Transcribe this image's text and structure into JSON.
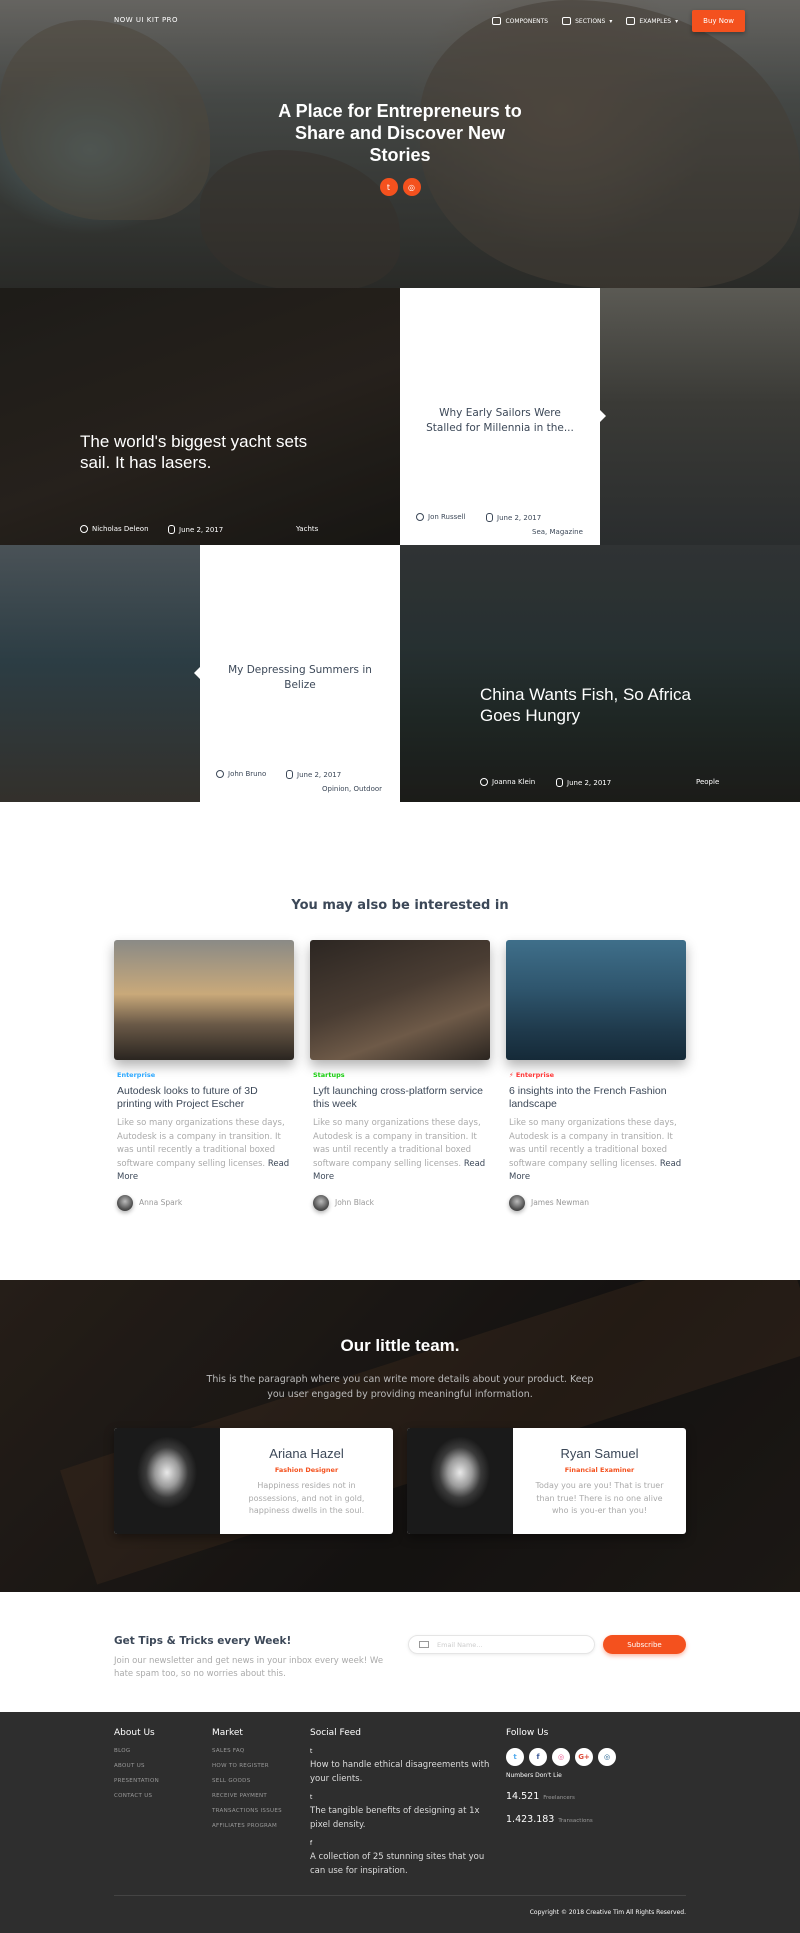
{
  "nav": {
    "brand": "NOW UI KIT PRO",
    "items": [
      {
        "label": "COMPONENTS"
      },
      {
        "label": "SECTIONS"
      },
      {
        "label": "EXAMPLES"
      }
    ],
    "buy_label": "Buy Now"
  },
  "hero": {
    "title": "A Place for Entrepreneurs to Share and Discover New Stories",
    "social": [
      {
        "icon": "twitter-icon",
        "glyph": "t"
      },
      {
        "icon": "instagram-icon",
        "glyph": "◎"
      }
    ]
  },
  "stories": [
    {
      "title": "The world's biggest yacht sets sail. It has lasers.",
      "author": "Nicholas Deleon",
      "date": "June 2, 2017",
      "tags": "Yachts"
    },
    {
      "title": "Why Early Sailors Were Stalled for Millennia in the...",
      "author": "Jon Russell",
      "date": "June 2, 2017",
      "tags": "Sea, Magazine"
    },
    {
      "title": "My Depressing Summers in Belize",
      "author": "John Bruno",
      "date": "June 2, 2017",
      "tags": "Opinion, Outdoor"
    },
    {
      "title": "China Wants Fish, So Africa Goes Hungry",
      "author": "Joanna Klein",
      "date": "June 2, 2017",
      "tags": "People"
    }
  ],
  "related": {
    "heading": "You may also be interested in",
    "cards": [
      {
        "category": "Enterprise",
        "category_color": "#2ca8ff",
        "title": "Autodesk looks to future of 3D printing with Project Escher",
        "desc": "Like so many organizations these days, Autodesk is a company in transition. It was until recently a traditional boxed software company selling licenses.",
        "more": "Read More",
        "author": "Anna Spark"
      },
      {
        "category": "Startups",
        "category_color": "#18ce0f",
        "title": "Lyft launching cross-platform service this week",
        "desc": "Like so many organizations these days, Autodesk is a company in transition. It was until recently a traditional boxed software company selling licenses.",
        "more": "Read More",
        "author": "John Black"
      },
      {
        "category": "Enterprise",
        "category_color": "#ff3636",
        "title": "6 insights into the French Fashion landscape",
        "desc": "Like so many organizations these days, Autodesk is a company in transition. It was until recently a traditional boxed software company selling licenses.",
        "more": "Read More",
        "author": "James Newman"
      }
    ]
  },
  "team": {
    "heading": "Our little team.",
    "paragraph": "This is the paragraph where you can write more details about your product. Keep you user engaged by providing meaningful information.",
    "members": [
      {
        "name": "Ariana Hazel",
        "role": "Fashion Designer",
        "quote": "Happiness resides not in possessions, and not in gold, happiness dwells in the soul."
      },
      {
        "name": "Ryan Samuel",
        "role": "Financial Examiner",
        "quote": "Today you are you! That is truer than true! There is no one alive who is you-er than you!"
      }
    ]
  },
  "newsletter": {
    "heading": "Get Tips & Tricks every Week!",
    "text": "Join our newsletter and get news in your inbox every week! We hate spam too, so no worries about this.",
    "placeholder": "Email Name...",
    "button": "Subscribe"
  },
  "footer": {
    "about": {
      "heading": "About Us",
      "links": [
        "BLOG",
        "ABOUT US",
        "PRESENTATION",
        "CONTACT US"
      ]
    },
    "market": {
      "heading": "Market",
      "links": [
        "SALES FAQ",
        "HOW TO REGISTER",
        "SELL GOODS",
        "RECEIVE PAYMENT",
        "TRANSACTIONS ISSUES",
        "AFFILIATES PROGRAM"
      ]
    },
    "social_feed": {
      "heading": "Social Feed",
      "items": [
        {
          "icon": "twitter-icon",
          "glyph": "t",
          "text": "How to handle ethical disagreements with your clients."
        },
        {
          "icon": "twitter-icon",
          "glyph": "t",
          "text": "The tangible benefits of designing at 1x pixel density."
        },
        {
          "icon": "facebook-icon",
          "glyph": "f",
          "text": "A collection of 25 stunning sites that you can use for inspiration."
        }
      ]
    },
    "follow": {
      "heading": "Follow Us",
      "buttons": [
        {
          "icon": "twitter-icon",
          "glyph": "t",
          "color": "#55acee"
        },
        {
          "icon": "facebook-icon",
          "glyph": "f",
          "color": "#3b5998"
        },
        {
          "icon": "dribbble-icon",
          "glyph": "◎",
          "color": "#ea4c89"
        },
        {
          "icon": "google-plus-icon",
          "glyph": "G+",
          "color": "#dd4b39"
        },
        {
          "icon": "instagram-icon",
          "glyph": "◎",
          "color": "#125688"
        }
      ]
    },
    "numbers_heading": "Numbers Don't Lie",
    "stats": [
      {
        "value": "14.521",
        "label": "Freelancers"
      },
      {
        "value": "1.423.183",
        "label": "Transactions"
      }
    ],
    "copyright": "Copyright © 2018 Creative Tim All Rights Reserved."
  }
}
